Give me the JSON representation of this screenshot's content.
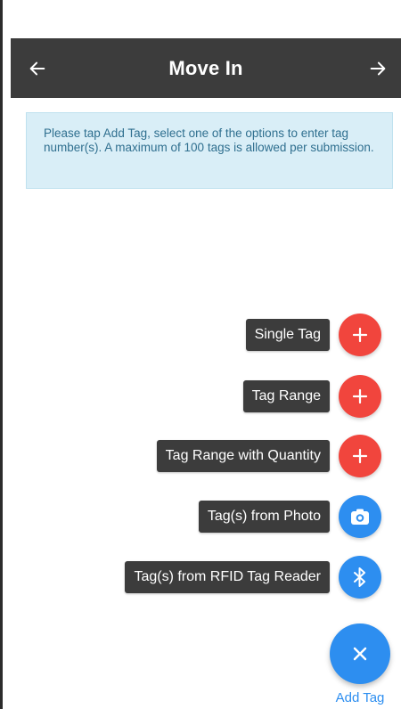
{
  "header": {
    "title": "Move In",
    "back_icon": "arrow-left-icon",
    "forward_icon": "arrow-right-icon"
  },
  "info": {
    "text": "Please tap Add Tag, select one of the options to enter tag number(s). A maximum of 100 tags is allowed per submission."
  },
  "fab_menu": [
    {
      "label": "Single Tag",
      "icon": "plus-icon",
      "color": "#f1453d"
    },
    {
      "label": "Tag Range",
      "icon": "plus-icon",
      "color": "#f1453d"
    },
    {
      "label": "Tag Range with Quantity",
      "icon": "plus-icon",
      "color": "#f1453d"
    },
    {
      "label": "Tag(s) from Photo",
      "icon": "camera-icon",
      "color": "#2d8ef0"
    },
    {
      "label": "Tag(s) from RFID Tag Reader",
      "icon": "bluetooth-icon",
      "color": "#2d8ef0"
    }
  ],
  "main_fab": {
    "label": "Add Tag",
    "icon": "close-icon",
    "color": "#2d8ef0"
  },
  "colors": {
    "app_bar": "#3c3c3c",
    "info_bg": "#d9eef7",
    "info_text": "#2f6f8f"
  }
}
